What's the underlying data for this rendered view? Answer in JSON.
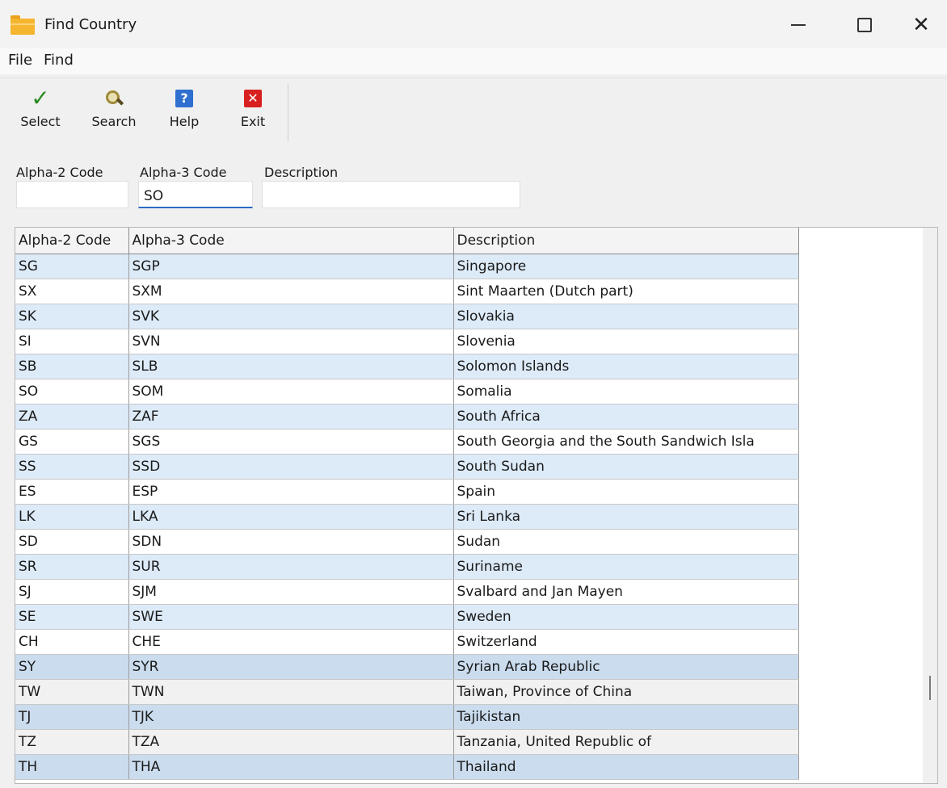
{
  "window": {
    "title": "Find Country",
    "icon": "folder-icon"
  },
  "menu": [
    "File",
    "Find"
  ],
  "toolbar": {
    "select_label": "Select",
    "search_label": "Search",
    "help_label": "Help",
    "exit_label": "Exit"
  },
  "filters": {
    "alpha2": {
      "label": "Alpha-2 Code",
      "value": ""
    },
    "alpha3": {
      "label": "Alpha-3 Code",
      "value": "SO"
    },
    "description": {
      "label": "Description",
      "value": ""
    }
  },
  "table": {
    "columns": [
      "Alpha-2 Code",
      "Alpha-3 Code",
      "Description"
    ],
    "rows": [
      [
        "SG",
        "SGP",
        "Singapore"
      ],
      [
        "SX",
        "SXM",
        "Sint Maarten (Dutch part)"
      ],
      [
        "SK",
        "SVK",
        "Slovakia"
      ],
      [
        "SI",
        "SVN",
        "Slovenia"
      ],
      [
        "SB",
        "SLB",
        "Solomon Islands"
      ],
      [
        "SO",
        "SOM",
        "Somalia"
      ],
      [
        "ZA",
        "ZAF",
        "South Africa"
      ],
      [
        "GS",
        "SGS",
        "South Georgia and the South Sandwich Isla"
      ],
      [
        "SS",
        "SSD",
        "South Sudan"
      ],
      [
        "ES",
        "ESP",
        "Spain"
      ],
      [
        "LK",
        "LKA",
        "Sri Lanka"
      ],
      [
        "SD",
        "SDN",
        "Sudan"
      ],
      [
        "SR",
        "SUR",
        "Suriname"
      ],
      [
        "SJ",
        "SJM",
        "Svalbard and Jan Mayen"
      ],
      [
        "SE",
        "SWE",
        "Sweden"
      ],
      [
        "CH",
        "CHE",
        "Switzerland"
      ],
      [
        "SY",
        "SYR",
        "Syrian Arab Republic"
      ],
      [
        "TW",
        "TWN",
        "Taiwan, Province of China"
      ],
      [
        "TJ",
        "TJK",
        "Tajikistan"
      ],
      [
        "TZ",
        "TZA",
        "Tanzania, United Republic of"
      ],
      [
        "TH",
        "THA",
        "Thailand"
      ]
    ]
  },
  "colors": {
    "row_alt": "#ddeaf8",
    "focus_underline": "#2b6cc4",
    "select_icon": "#2a8a20",
    "help_icon": "#2f6fd0",
    "exit_icon": "#d82020"
  }
}
